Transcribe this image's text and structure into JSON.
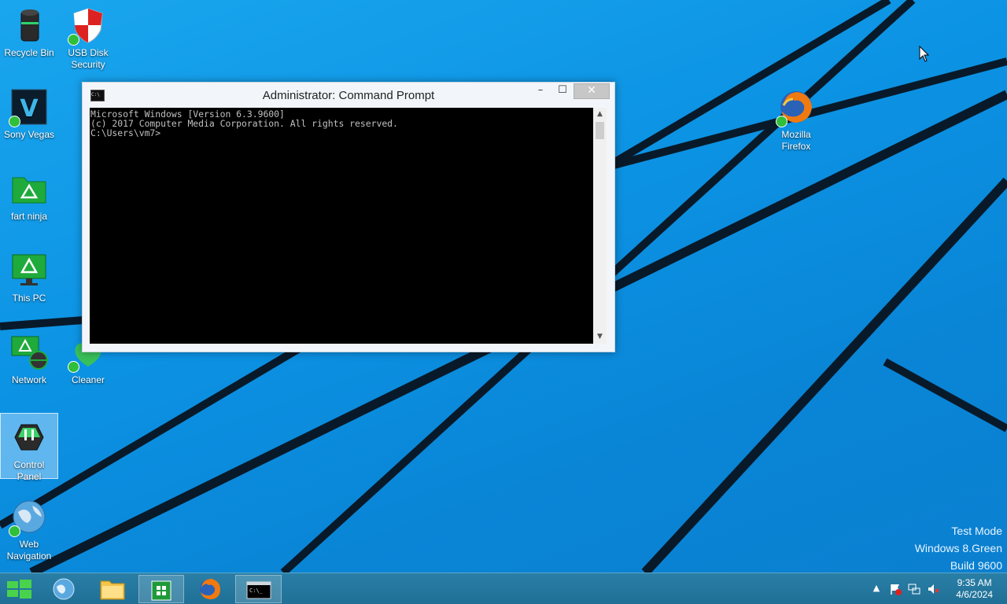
{
  "desktop_icons": {
    "recycle_bin": "Recycle Bin",
    "usb_disk_security": "USB Disk Security",
    "sony_vegas": "Sony Vegas",
    "fart_ninja": "fart ninja",
    "this_pc": "This PC",
    "network": "Network",
    "cleaner": "Cleaner",
    "control_panel": "Control Panel",
    "web_navigation": "Web Navigation",
    "mozilla_firefox": "Mozilla Firefox"
  },
  "cmd_window": {
    "title": "Administrator: Command Prompt",
    "icon_text": "C:\\",
    "minimize_symbol": "–",
    "maximize_symbol": "☐",
    "close_symbol": "✕",
    "console_lines": [
      "Microsoft Windows [Version 6.3.9600]",
      "(c) 2017 Computer Media Corporation. All rights reserved.",
      "",
      "C:\\Users\\vm7>"
    ]
  },
  "watermark": {
    "line1": "Test Mode",
    "line2": "Windows 8.Green",
    "line3": "Build 9600"
  },
  "taskbar": {
    "clock_time": "9:35 AM",
    "clock_date": "4/6/2024"
  },
  "colors": {
    "desktop_blue": "#0c93e4",
    "taskbar": "#2a7fa6",
    "console_bg": "#000000",
    "console_text": "#c0c0c0"
  }
}
